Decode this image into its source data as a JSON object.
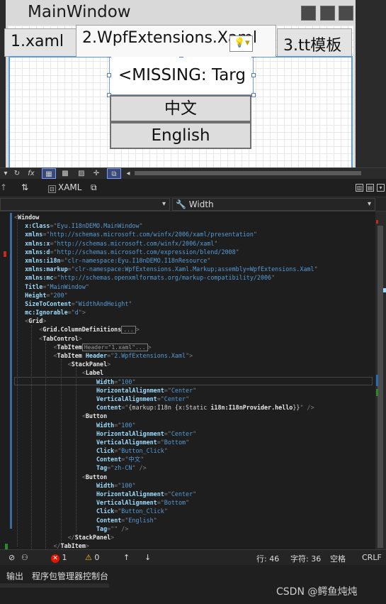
{
  "designer": {
    "window_title": "MainWindow",
    "tabs": [
      "1.xaml",
      "2.WpfExtensions.Xaml",
      "3.tt模板"
    ],
    "label_text": "<MISSING: Targ",
    "buttons": [
      "中文",
      "English"
    ]
  },
  "design_toolbar": {
    "fx_label": "fx"
  },
  "pane_tabs": {
    "swap_icon": "swap-arrows-icon",
    "xaml_label": "XAML"
  },
  "navbar": {
    "property": "Width"
  },
  "code": {
    "line1": "Window",
    "window_attrs": [
      [
        "x:Class",
        "Eyu.I18nDEMO.MainWindow"
      ],
      [
        "xmlns",
        "http://schemas.microsoft.com/winfx/2006/xaml/presentation"
      ],
      [
        "xmlns:x",
        "http://schemas.microsoft.com/winfx/2006/xaml"
      ],
      [
        "xmlns:d",
        "http://schemas.microsoft.com/expression/blend/2008"
      ],
      [
        "xmlns:i18n",
        "clr-namespace:Eyu.I18nDEMO.I18nResource"
      ],
      [
        "xmlns:markup",
        "clr-namespace:WpfExtensions.Xaml.Markup;assembly=WpfExtensions.Xaml"
      ],
      [
        "xmlns:mc",
        "http://schemas.openxmlformats.org/markup-compatibility/2006"
      ],
      [
        "Title",
        "MainWindow"
      ],
      [
        "Height",
        "200"
      ],
      [
        "SizeToContent",
        "WidthAndHeight"
      ],
      [
        "mc:Ignorable",
        "d"
      ]
    ],
    "grid": "Grid",
    "grid_coldefs": "Grid.ColumnDefinitions",
    "collapsed_dots": "...",
    "tabcontrol": "TabControl",
    "tabitem": "TabItem",
    "tabitem1_collapsed": "Header=\"1.xaml\"...",
    "tabitem2_header_attr": "Header",
    "tabitem2_header_val": "2.WpfExtensions.Xaml",
    "stackpanel": "StackPanel",
    "label": "Label",
    "label_attrs": [
      [
        "Width",
        "100"
      ],
      [
        "HorizontalAlignment",
        "Center"
      ],
      [
        "VerticalAlignment",
        "Center"
      ]
    ],
    "label_content_attr": "Content",
    "label_content_pre": "{markup:I18n {x:Static ",
    "label_content_res": "i18n:I18nProvider.hello",
    "label_content_post": "}}",
    "button": "Button",
    "button1_attrs": [
      [
        "Width",
        "100"
      ],
      [
        "HorizontalAlignment",
        "Center"
      ],
      [
        "VerticalAlignment",
        "Bottom"
      ],
      [
        "Click",
        "Button_Click"
      ],
      [
        "Content",
        "中文"
      ],
      [
        "Tag",
        "zh-CN"
      ]
    ],
    "button2_attrs": [
      [
        "Width",
        "100"
      ],
      [
        "HorizontalAlignment",
        "Center"
      ],
      [
        "VerticalAlignment",
        "Bottom"
      ],
      [
        "Click",
        "Button_Click"
      ],
      [
        "Content",
        "English"
      ],
      [
        "Tag",
        ""
      ]
    ],
    "stackpanel_close": "StackPanel",
    "tabitem_close": "TabItem"
  },
  "status": {
    "errors": "1",
    "warnings": "0",
    "line": "行: 46",
    "char": "字符: 36",
    "space": "空格",
    "eol": "CRLF"
  },
  "bottom": {
    "tab_output": "输出",
    "tab_pmc": "程序包管理器控制台",
    "watermark": "CSDN @鳄鱼炖炖"
  },
  "colors": {
    "bg": "#1e1e1e",
    "element": "#e8e8e8",
    "attr": "#9cdcfe",
    "value": "#569cd6",
    "selection": "#5b9bd5"
  }
}
